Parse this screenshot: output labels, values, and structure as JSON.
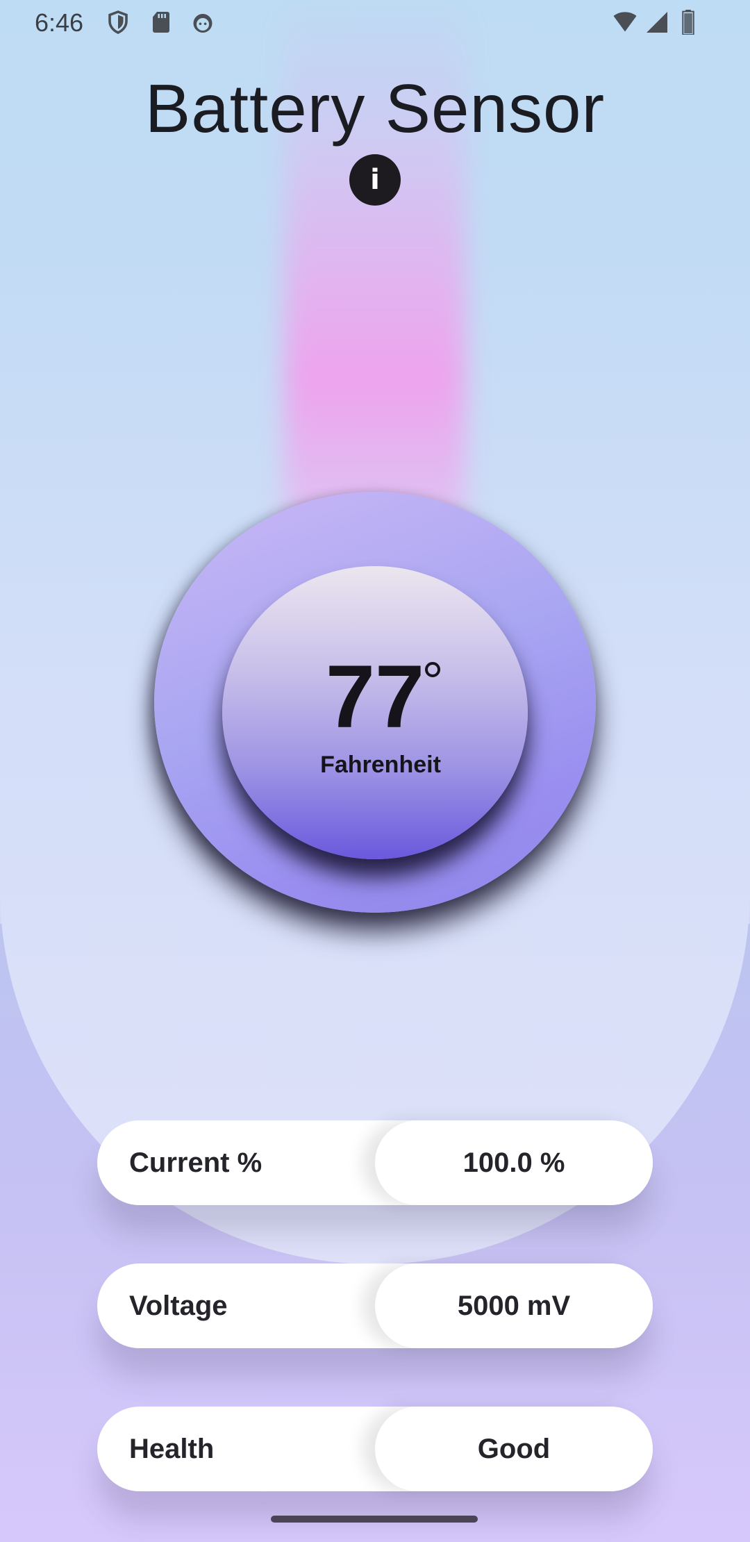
{
  "status_bar": {
    "time": "6:46",
    "left_icons": [
      "shield-icon",
      "sd-card-icon",
      "android-face-icon"
    ],
    "right_icons": [
      "wifi-icon",
      "cell-signal-icon",
      "battery-icon"
    ]
  },
  "header": {
    "title": "Battery Sensor",
    "info_icon_glyph": "i"
  },
  "temperature": {
    "value": "77",
    "unit": "Fahrenheit"
  },
  "stats": [
    {
      "label": "Current %",
      "value": "100.0 %"
    },
    {
      "label": "Voltage",
      "value": "5000 mV"
    },
    {
      "label": "Health",
      "value": "Good"
    }
  ],
  "colors": {
    "accent_dial": "#9a8ff0",
    "inner_disc_bottom": "#6a59dd",
    "glow": "#f0a0ec"
  }
}
